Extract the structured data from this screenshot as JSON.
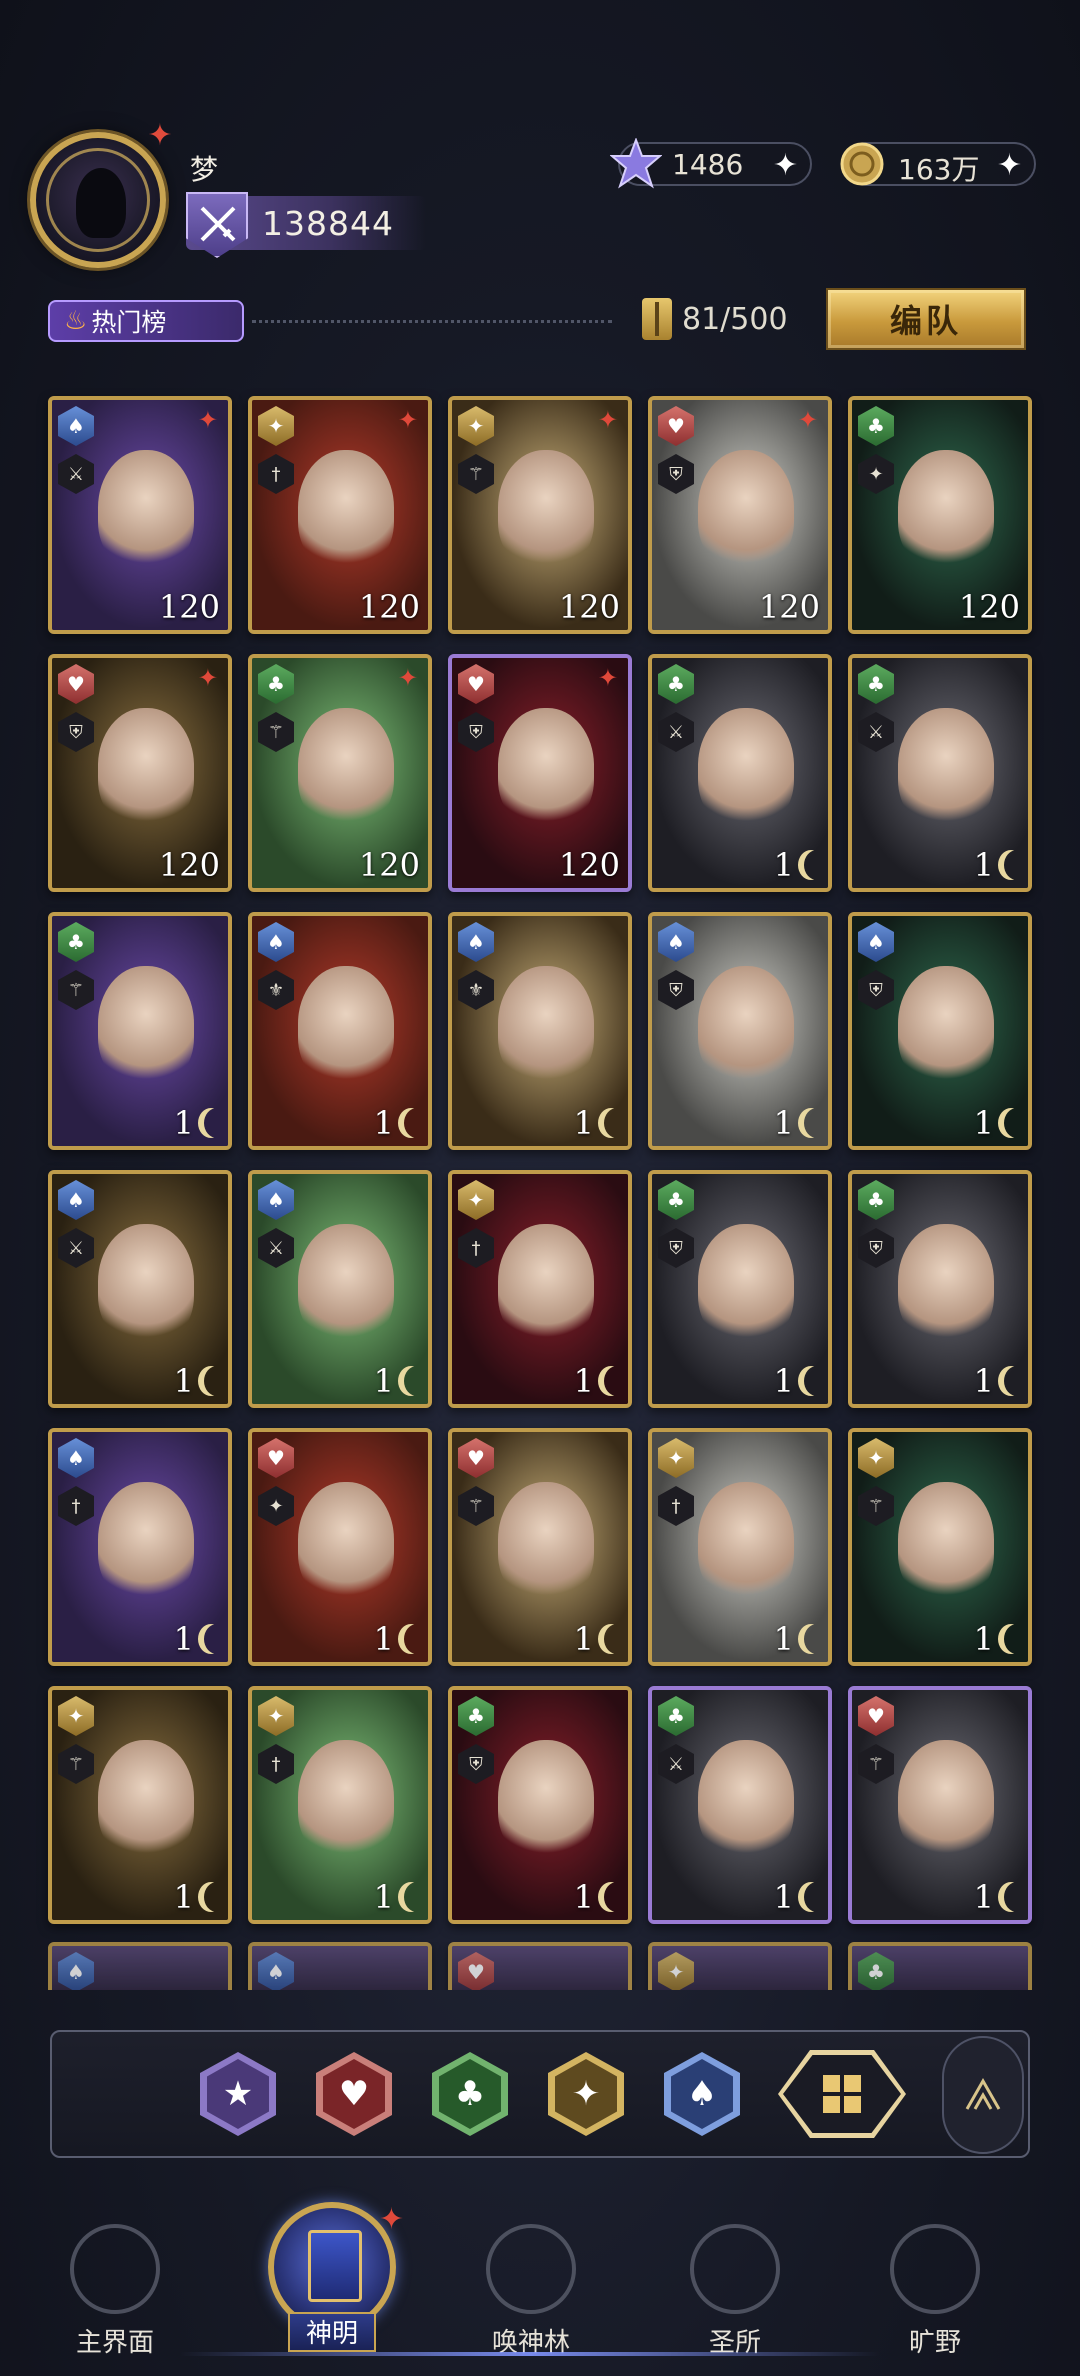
{
  "player": {
    "name": "梦",
    "power": "138844"
  },
  "currencies": {
    "gems": "1486",
    "gold": "163万"
  },
  "toolbar": {
    "hot_rank_label": "热门榜",
    "slot_count": "81/500",
    "team_button": "编队"
  },
  "cards": [
    {
      "suit": "spade",
      "cls": "⚔",
      "level": "120",
      "star": true,
      "frame": "gold"
    },
    {
      "suit": "diamond",
      "cls": "†",
      "level": "120",
      "star": true,
      "frame": "gold"
    },
    {
      "suit": "diamond",
      "cls": "⚚",
      "level": "120",
      "star": true,
      "frame": "gold"
    },
    {
      "suit": "heart",
      "cls": "⛨",
      "level": "120",
      "star": true,
      "frame": "gold"
    },
    {
      "suit": "club",
      "cls": "✦",
      "level": "120",
      "star": false,
      "frame": "gold"
    },
    {
      "suit": "heart",
      "cls": "⛨",
      "level": "120",
      "star": true,
      "frame": "gold"
    },
    {
      "suit": "club",
      "cls": "⚚",
      "level": "120",
      "star": true,
      "frame": "gold"
    },
    {
      "suit": "heart",
      "cls": "⛨",
      "level": "120",
      "star": true,
      "frame": "purple"
    },
    {
      "suit": "club",
      "cls": "⚔",
      "level": "1",
      "star": false,
      "frame": "gold"
    },
    {
      "suit": "club",
      "cls": "⚔",
      "level": "1",
      "star": false,
      "frame": "gold"
    },
    {
      "suit": "club",
      "cls": "⚚",
      "level": "1",
      "star": false,
      "frame": "gold"
    },
    {
      "suit": "spade",
      "cls": "⚜",
      "level": "1",
      "star": false,
      "frame": "gold"
    },
    {
      "suit": "spade",
      "cls": "⚜",
      "level": "1",
      "star": false,
      "frame": "gold"
    },
    {
      "suit": "spade",
      "cls": "⛨",
      "level": "1",
      "star": false,
      "frame": "gold"
    },
    {
      "suit": "spade",
      "cls": "⛨",
      "level": "1",
      "star": false,
      "frame": "gold"
    },
    {
      "suit": "spade",
      "cls": "⚔",
      "level": "1",
      "star": false,
      "frame": "gold"
    },
    {
      "suit": "spade",
      "cls": "⚔",
      "level": "1",
      "star": false,
      "frame": "gold"
    },
    {
      "suit": "diamond",
      "cls": "†",
      "level": "1",
      "star": false,
      "frame": "gold"
    },
    {
      "suit": "club",
      "cls": "⛨",
      "level": "1",
      "star": false,
      "frame": "gold"
    },
    {
      "suit": "club",
      "cls": "⛨",
      "level": "1",
      "star": false,
      "frame": "gold"
    },
    {
      "suit": "spade",
      "cls": "†",
      "level": "1",
      "star": false,
      "frame": "gold"
    },
    {
      "suit": "heart",
      "cls": "✦",
      "level": "1",
      "star": false,
      "frame": "gold"
    },
    {
      "suit": "heart",
      "cls": "⚚",
      "level": "1",
      "star": false,
      "frame": "gold"
    },
    {
      "suit": "diamond",
      "cls": "†",
      "level": "1",
      "star": false,
      "frame": "gold"
    },
    {
      "suit": "diamond",
      "cls": "⚚",
      "level": "1",
      "star": false,
      "frame": "gold"
    },
    {
      "suit": "diamond",
      "cls": "⚚",
      "level": "1",
      "star": false,
      "frame": "gold"
    },
    {
      "suit": "diamond",
      "cls": "†",
      "level": "1",
      "star": false,
      "frame": "gold"
    },
    {
      "suit": "club",
      "cls": "⛨",
      "level": "1",
      "star": false,
      "frame": "gold"
    },
    {
      "suit": "club",
      "cls": "⚔",
      "level": "1",
      "star": false,
      "frame": "purple"
    },
    {
      "suit": "heart",
      "cls": "⚚",
      "level": "1",
      "star": false,
      "frame": "purple"
    }
  ],
  "partial_row_suits": [
    "spade",
    "spade",
    "heart",
    "diamond",
    "club"
  ],
  "filters": {
    "star": "★",
    "heart": "♥",
    "club": "♣",
    "diamond": "✦",
    "spade": "♠"
  },
  "nav": {
    "home": "主界面",
    "gods": "神明",
    "summon": "唤神林",
    "sanctuary": "圣所",
    "wild": "旷野"
  },
  "colors": {
    "gold_frame": "#c09c4b",
    "purple_frame": "#9a7bd4",
    "accent_red": "#e0493a"
  }
}
